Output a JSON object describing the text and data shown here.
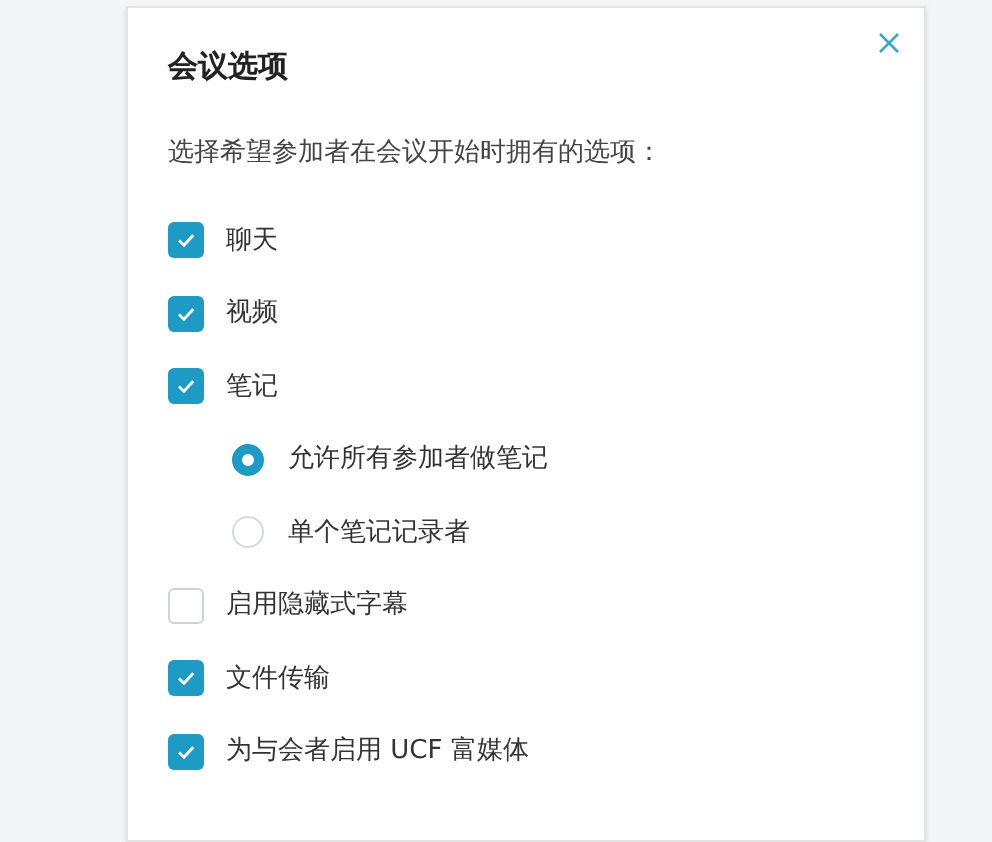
{
  "dialog": {
    "title": "会议选项",
    "description": "选择希望参加者在会议开始时拥有的选项：",
    "options": [
      {
        "kind": "checkbox",
        "label": "聊天",
        "checked": true
      },
      {
        "kind": "checkbox",
        "label": "视频",
        "checked": true
      },
      {
        "kind": "checkbox",
        "label": "笔记",
        "checked": true,
        "children": [
          {
            "kind": "radio",
            "label": "允许所有参加者做笔记",
            "selected": true
          },
          {
            "kind": "radio",
            "label": "单个笔记记录者",
            "selected": false
          }
        ]
      },
      {
        "kind": "checkbox",
        "label": "启用隐藏式字幕",
        "checked": false
      },
      {
        "kind": "checkbox",
        "label": "文件传输",
        "checked": true
      },
      {
        "kind": "checkbox",
        "label": "为与会者启用 UCF 富媒体",
        "checked": true
      }
    ]
  }
}
